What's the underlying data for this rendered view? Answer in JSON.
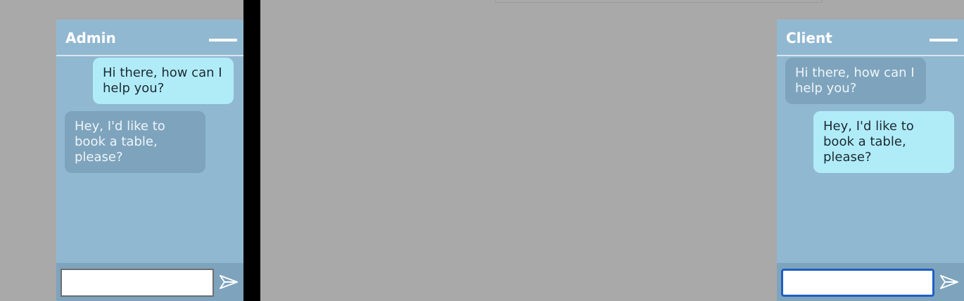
{
  "admin": {
    "title": "Admin",
    "messages": [
      {
        "from": "admin",
        "text": "Hi there, how can I help you?"
      },
      {
        "from": "client",
        "text": "Hey, I'd like to book a table, please?"
      }
    ],
    "input": {
      "value": "",
      "placeholder": ""
    }
  },
  "client": {
    "title": "Client",
    "messages": [
      {
        "from": "admin",
        "text": "Hi there, how can I help you?"
      },
      {
        "from": "client",
        "text": "Hey, I'd like to book a table, please?"
      }
    ],
    "input": {
      "value": "",
      "placeholder": ""
    }
  },
  "colors": {
    "panel": "#91b8d1",
    "own_bubble": "#b0ecf8",
    "other_bubble": "#7ea4bd",
    "focus_ring": "#1f5fc4",
    "background": "#a9a9a9"
  },
  "icons": {
    "minimize": "minimize-icon",
    "send": "send-icon"
  }
}
